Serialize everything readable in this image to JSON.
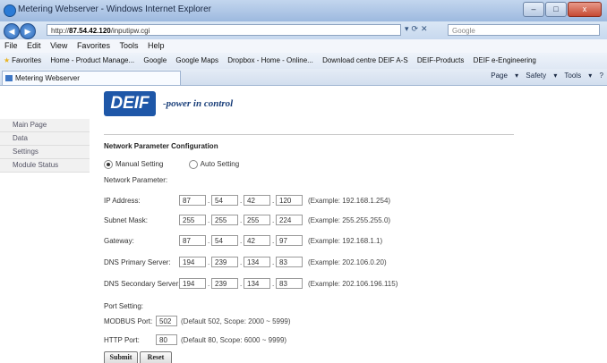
{
  "window": {
    "title": "Metering Webserver - Windows Internet Explorer",
    "min": "–",
    "max": "□",
    "close": "x"
  },
  "address": {
    "prefix": "http://",
    "domain": "87.54.42.120",
    "path": "/inputipw.cgi",
    "search_placeholder": "Google"
  },
  "menu": [
    "File",
    "Edit",
    "View",
    "Favorites",
    "Tools",
    "Help"
  ],
  "favorites": [
    "Favorites",
    "Home - Product Manage...",
    "Google",
    "Google Maps",
    "Dropbox - Home - Online...",
    "Download centre DEIF A-S",
    "DEIF-Products",
    "DEIF e-Engineering"
  ],
  "tab": {
    "title": "Metering Webserver"
  },
  "commandbar": "Page ▾  Safety ▾  Tools ▾  ?",
  "logo": {
    "brand": "DEIF",
    "tagline": "-power in control"
  },
  "sidebar": [
    "Main Page",
    "Data",
    "Settings",
    "Module Status"
  ],
  "form": {
    "heading": "Network Parameter Configuration",
    "manual_label": "Manual Setting",
    "auto_label": "Auto Setting",
    "mode": "manual",
    "netparam_label": "Network Parameter:",
    "fields": [
      {
        "label": "IP Address:",
        "octets": [
          "87",
          "54",
          "42",
          "120"
        ],
        "example": "(Example: 192.168.1.254)"
      },
      {
        "label": "Subnet Mask:",
        "octets": [
          "255",
          "255",
          "255",
          "224"
        ],
        "example": "(Example: 255.255.255.0)"
      },
      {
        "label": "Gateway:",
        "octets": [
          "87",
          "54",
          "42",
          "97"
        ],
        "example": "(Example: 192.168.1.1)"
      },
      {
        "label": "DNS Primary Server:",
        "octets": [
          "194",
          "239",
          "134",
          "83"
        ],
        "example": "(Example: 202.106.0.20)"
      },
      {
        "label": "DNS Secondary Server:",
        "octets": [
          "194",
          "239",
          "134",
          "83"
        ],
        "example": "(Example: 202.106.196.115)"
      }
    ],
    "port_setting_label": "Port Setting:",
    "modbus": {
      "label": "MODBUS Port:",
      "value": "502",
      "note": "(Default 502, Scope: 2000 ~ 5999)"
    },
    "http": {
      "label": "HTTP Port:",
      "value": "80",
      "note": "(Default 80, Scope: 6000 ~ 9999)"
    },
    "submit_label": "Submit",
    "reset_label": "Reset"
  }
}
